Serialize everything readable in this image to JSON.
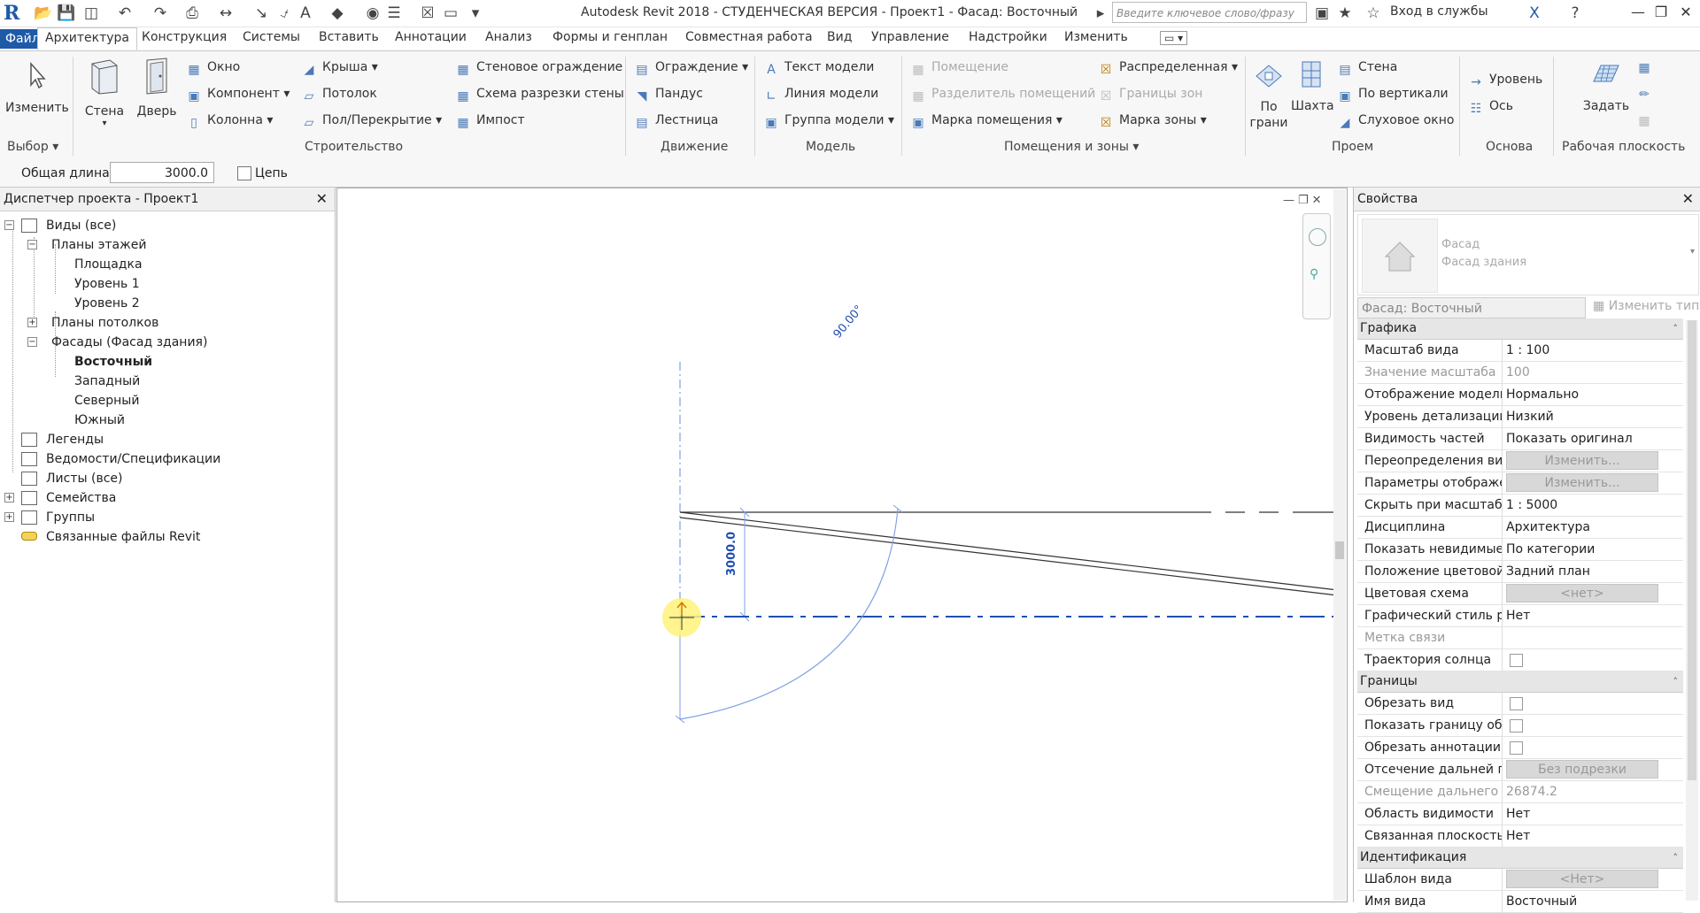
{
  "window": {
    "title": "Autodesk Revit 2018 - СТУДЕНЧЕСКАЯ ВЕРСИЯ -     Проект1 - Фасад: Восточный",
    "search_placeholder": "Введите ключевое слово/фразу",
    "login": "Вход в службы"
  },
  "tabs": [
    "Файл",
    "Архитектура",
    "Конструкция",
    "Системы",
    "Вставить",
    "Аннотации",
    "Анализ",
    "Формы и генплан",
    "Совместная работа",
    "Вид",
    "Управление",
    "Надстройки",
    "Изменить"
  ],
  "ribbon": {
    "select": {
      "modify": "Изменить",
      "panel": "Выбор"
    },
    "build": {
      "wall": "Стена",
      "door": "Дверь",
      "window": "Окно",
      "component": "Компонент",
      "column": "Колонна",
      "roof": "Крыша",
      "ceiling": "Потолок",
      "floor": "Пол/Перекрытие",
      "curtain_system": "Стеновое ограждение",
      "curtain_grid": "Схема разрезки стены",
      "mullion": "Импост",
      "panel": "Строительство"
    },
    "circulation": {
      "railing": "Ограждение",
      "ramp": "Пандус",
      "stair": "Лестница",
      "panel": "Движение"
    },
    "model": {
      "text": "Текст модели",
      "line": "Линия модели",
      "group": "Группа модели",
      "panel": "Модель"
    },
    "room": {
      "room": "Помещение",
      "separator": "Разделитель помещений",
      "tag": "Марка помещения",
      "area": "Распределенная",
      "boundary": "Границы зон",
      "area_tag": "Марка зоны",
      "panel": "Помещения и зоны"
    },
    "opening": {
      "by_face": "По грани",
      "shaft": "Шахта",
      "wall": "Стена",
      "vertical": "По вертикали",
      "dormer": "Слуховое окно",
      "panel": "Проем"
    },
    "datum": {
      "level": "Уровень",
      "grid": "Ось",
      "panel": "Основа"
    },
    "workplane": {
      "set": "Задать",
      "panel": "Рабочая плоскость"
    }
  },
  "options": {
    "length_label": "Общая длина:",
    "length_value": "3000.0",
    "chain_label": "Цепь"
  },
  "browser": {
    "title": "Диспетчер проекта - Проект1",
    "nodes": {
      "views": "Виды (все)",
      "floor_plans": "Планы этажей",
      "site": "Площадка",
      "level1": "Уровень 1",
      "level2": "Уровень 2",
      "ceiling_plans": "Планы потолков",
      "elevations": "Фасады (Фасад здания)",
      "east": "Восточный",
      "west": "Западный",
      "north": "Северный",
      "south": "Южный",
      "legends": "Легенды",
      "schedules": "Ведомости/Спецификации",
      "sheets": "Листы (все)",
      "families": "Семейства",
      "groups": "Группы",
      "links": "Связанные файлы Revit"
    }
  },
  "canvas": {
    "angle_label": "90.00°",
    "dim_label": "3000.0"
  },
  "properties": {
    "title": "Свойства",
    "type_line1": "Фасад",
    "type_line2": "Фасад здания",
    "type_selector": "Фасад: Восточный",
    "edit_type": "Изменить тип",
    "groups": [
      {
        "name": "Графика",
        "rows": [
          {
            "k": "Масштаб вида",
            "v": "1 : 100"
          },
          {
            "k": "Значение масштаба",
            "v": "100",
            "dim": true
          },
          {
            "k": "Отображение модели",
            "v": "Нормально"
          },
          {
            "k": "Уровень детализации",
            "v": "Низкий"
          },
          {
            "k": "Видимость частей",
            "v": "Показать оригинал"
          },
          {
            "k": "Переопределения ви...",
            "btn": "Изменить..."
          },
          {
            "k": "Параметры отображе...",
            "btn": "Изменить..."
          },
          {
            "k": "Скрыть при масштаба...",
            "v": "1 : 5000"
          },
          {
            "k": "Дисциплина",
            "v": "Архитектура"
          },
          {
            "k": "Показать невидимые ...",
            "v": "По категории"
          },
          {
            "k": "Положение цветовой ...",
            "v": "Задний план"
          },
          {
            "k": "Цветовая схема",
            "btn": "<нет>"
          },
          {
            "k": "Графический стиль ра...",
            "v": "Нет"
          },
          {
            "k": "Метка связи",
            "v": "",
            "dim": true
          },
          {
            "k": "Траектория солнца",
            "cb": true
          }
        ]
      },
      {
        "name": "Границы",
        "rows": [
          {
            "k": "Обрезать вид",
            "cb": true
          },
          {
            "k": "Показать границу обр...",
            "cb": true
          },
          {
            "k": "Обрезать аннотации",
            "cb": true
          },
          {
            "k": "Отсечение дальней п...",
            "btn": "Без подрезки"
          },
          {
            "k": "Смещение дальнего п...",
            "v": "26874.2",
            "dim": true
          },
          {
            "k": "Область видимости",
            "v": "Нет"
          },
          {
            "k": "Связанная плоскость",
            "v": "Нет"
          }
        ]
      },
      {
        "name": "Идентификация",
        "rows": [
          {
            "k": "Шаблон вида",
            "btn": "<Нет>"
          },
          {
            "k": "Имя вида",
            "v": "Восточный"
          }
        ]
      }
    ]
  },
  "colors": {
    "accent": "#1e5aa8",
    "dim_blue": "#1f4fb0",
    "sketch_blue": "#7f9fe6"
  }
}
